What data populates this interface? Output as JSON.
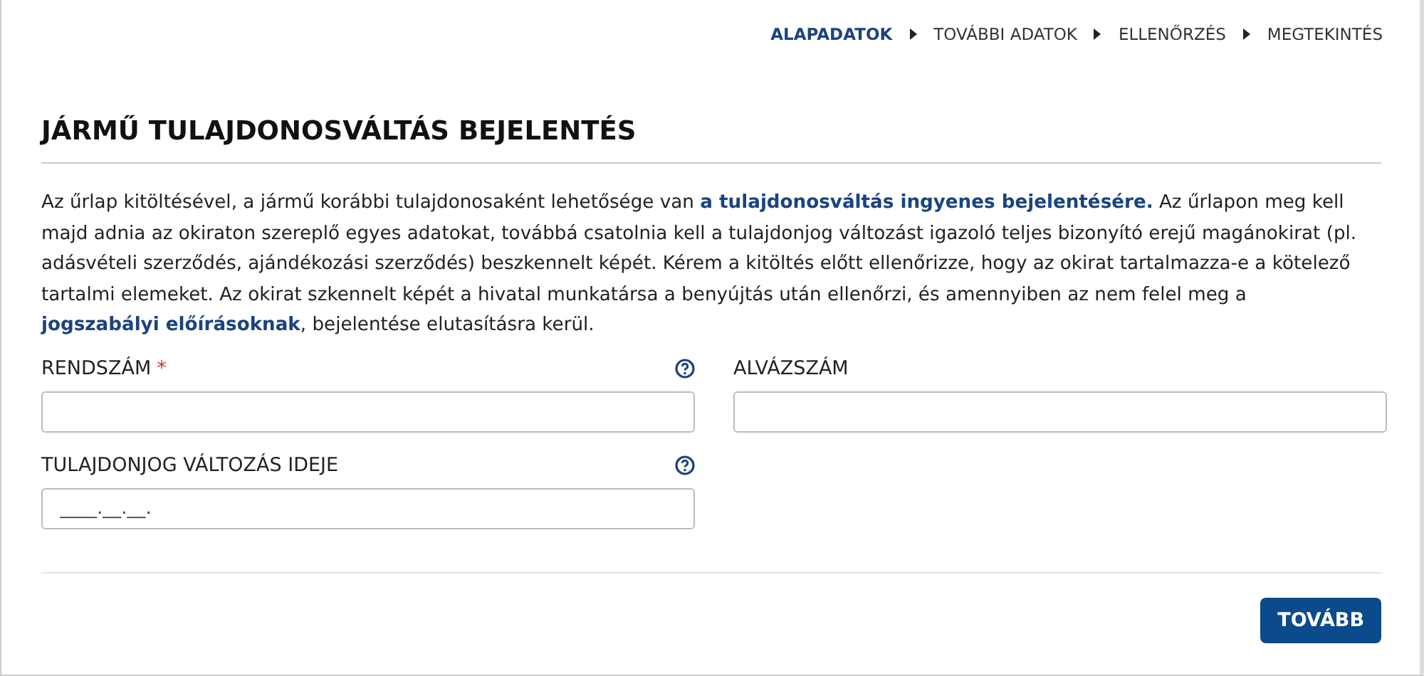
{
  "steps": [
    {
      "label": "ALAPADATOK",
      "selected": true
    },
    {
      "label": "TOVÁBBI ADATOK",
      "selected": false
    },
    {
      "label": "ELLENŐRZÉS",
      "selected": false
    },
    {
      "label": "MEGTEKINTÉS",
      "selected": false
    }
  ],
  "title": "JÁRMŰ TULAJDONOSVÁLTÁS BEJELENTÉS",
  "intro": "Az űrlap kitöltésével, a jármű korábbi tulajdonosaként lehetősége van **a tulajdonosváltás ingyenes bejelentésére.** Az űrlapon meg kell majd adnia az okiraton szereplő egyes adatokat, továbbá csatolnia kell a tulajdonjog változást igazoló teljes bizonyító erejű magánokirat (pl. adásvételi szerződés, ajándékozási szerződés) beszkennelt képét. Kérem a kitöltés előtt ellenőrizze, hogy az okirat tartalmazza-e a kötelező tartalmi elemeket. Az okirat szkennelt képét a hivatal munkatársa a benyújtás után ellenőrzi, és amennyiben az nem felel meg a **jogszabályi előírásoknak**, bejelentése elutasításra kerül.",
  "fields": [
    {
      "label": "RENDSZÁM",
      "required_mark": "*",
      "help": true
    },
    {
      "label": "ALVÁZSZÁM",
      "help": false
    },
    {
      "label": "TULAJDONJOG VÁLTOZÁS IDEJE",
      "help": true,
      "placeholder": "____.__.__."
    }
  ],
  "button": "TOVÁBB"
}
